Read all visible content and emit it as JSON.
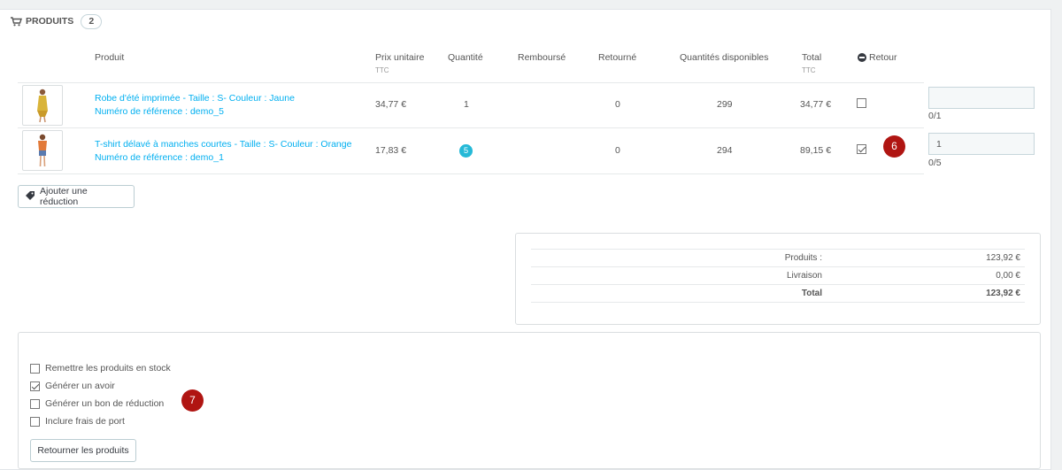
{
  "panel": {
    "title": "PRODUITS",
    "count": "2"
  },
  "columns": {
    "product": "Produit",
    "unit_price": "Prix unitaire",
    "unit_price_sub": "TTC",
    "quantity": "Quantité",
    "refunded": "Remboursé",
    "returned": "Retourné",
    "available": "Quantités disponibles",
    "total": "Total",
    "total_sub": "TTC",
    "return": "Retour"
  },
  "rows": [
    {
      "name": "Robe d'été imprimée - Taille : S- Couleur : Jaune",
      "reference": "Numéro de référence : demo_5",
      "unit_price": "34,77 €",
      "quantity": "1",
      "returned": "0",
      "available": "299",
      "total": "34,77 €",
      "return_checked": false,
      "input_value": "",
      "limit": "0/1"
    },
    {
      "name": "T-shirt délavé à manches courtes - Taille : S- Couleur : Orange",
      "reference": "Numéro de référence : demo_1",
      "unit_price": "17,83 €",
      "quantity": "5",
      "returned": "0",
      "available": "294",
      "total": "89,15 €",
      "return_checked": true,
      "input_value": "1",
      "limit": "0/5"
    }
  ],
  "markers": {
    "first": "6",
    "second": "7"
  },
  "add_discount_button": "Ajouter une réduction",
  "totals": {
    "products_label": "Produits :",
    "products_value": "123,92 €",
    "shipping_label": "Livraison",
    "shipping_value": "0,00 €",
    "total_label": "Total",
    "total_value": "123,92 €"
  },
  "options": [
    {
      "label": "Remettre les produits en stock",
      "checked": false
    },
    {
      "label": "Générer un avoir",
      "checked": true
    },
    {
      "label": "Générer un bon de réduction",
      "checked": false
    },
    {
      "label": "Inclure frais de port",
      "checked": false
    }
  ],
  "return_button": "Retourner les produits",
  "colors": {
    "link": "#00aff0",
    "badge": "#25b9d7",
    "marker": "#b01512"
  }
}
